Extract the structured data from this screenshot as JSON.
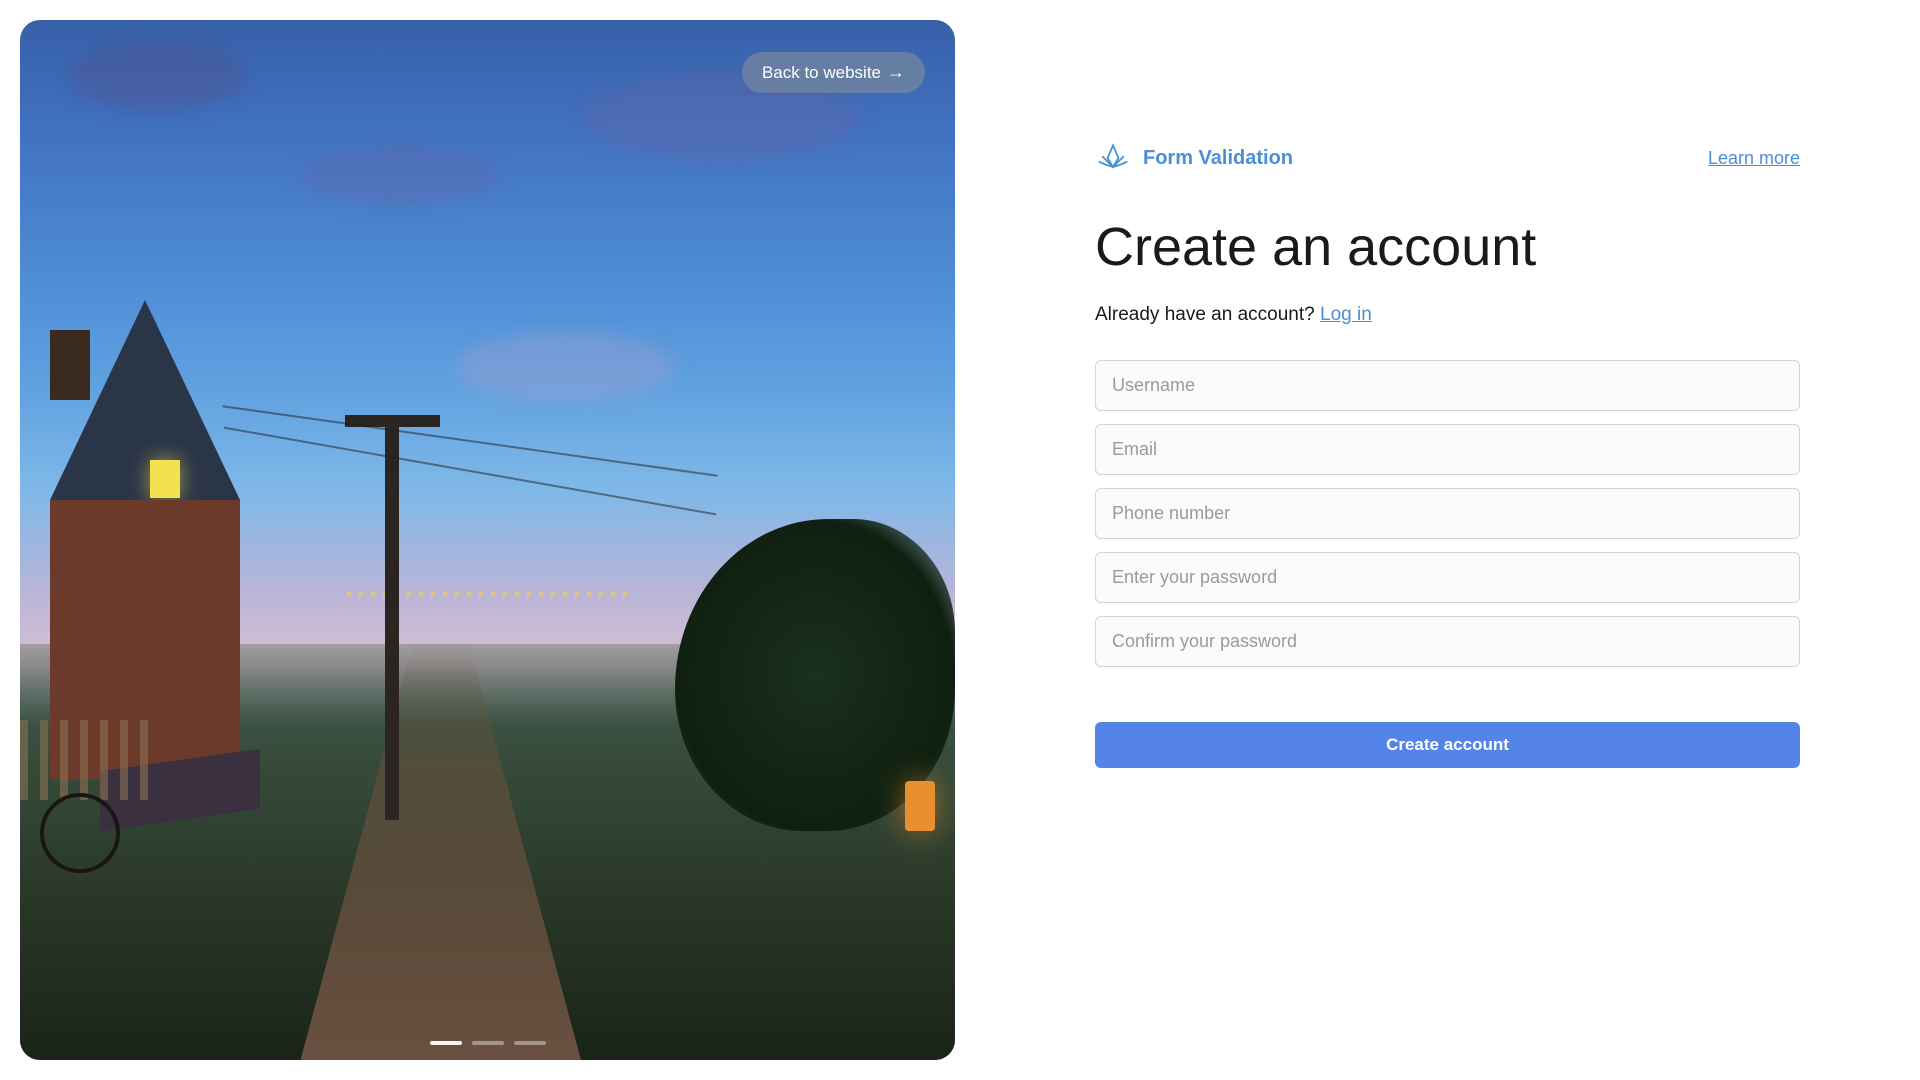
{
  "left": {
    "back_button": "Back to website",
    "arrow": "→"
  },
  "header": {
    "brand": "Form Validation",
    "learn_more": "Learn more"
  },
  "main": {
    "title": "Create an account",
    "subtitle_prefix": "Already have an account? ",
    "login_link": "Log in"
  },
  "form": {
    "username_placeholder": "Username",
    "email_placeholder": "Email",
    "phone_placeholder": "Phone number",
    "password_placeholder": "Enter your password",
    "confirm_password_placeholder": "Confirm your password",
    "submit_label": "Create account"
  },
  "colors": {
    "accent": "#4a8fd8",
    "button": "#5584e8"
  }
}
